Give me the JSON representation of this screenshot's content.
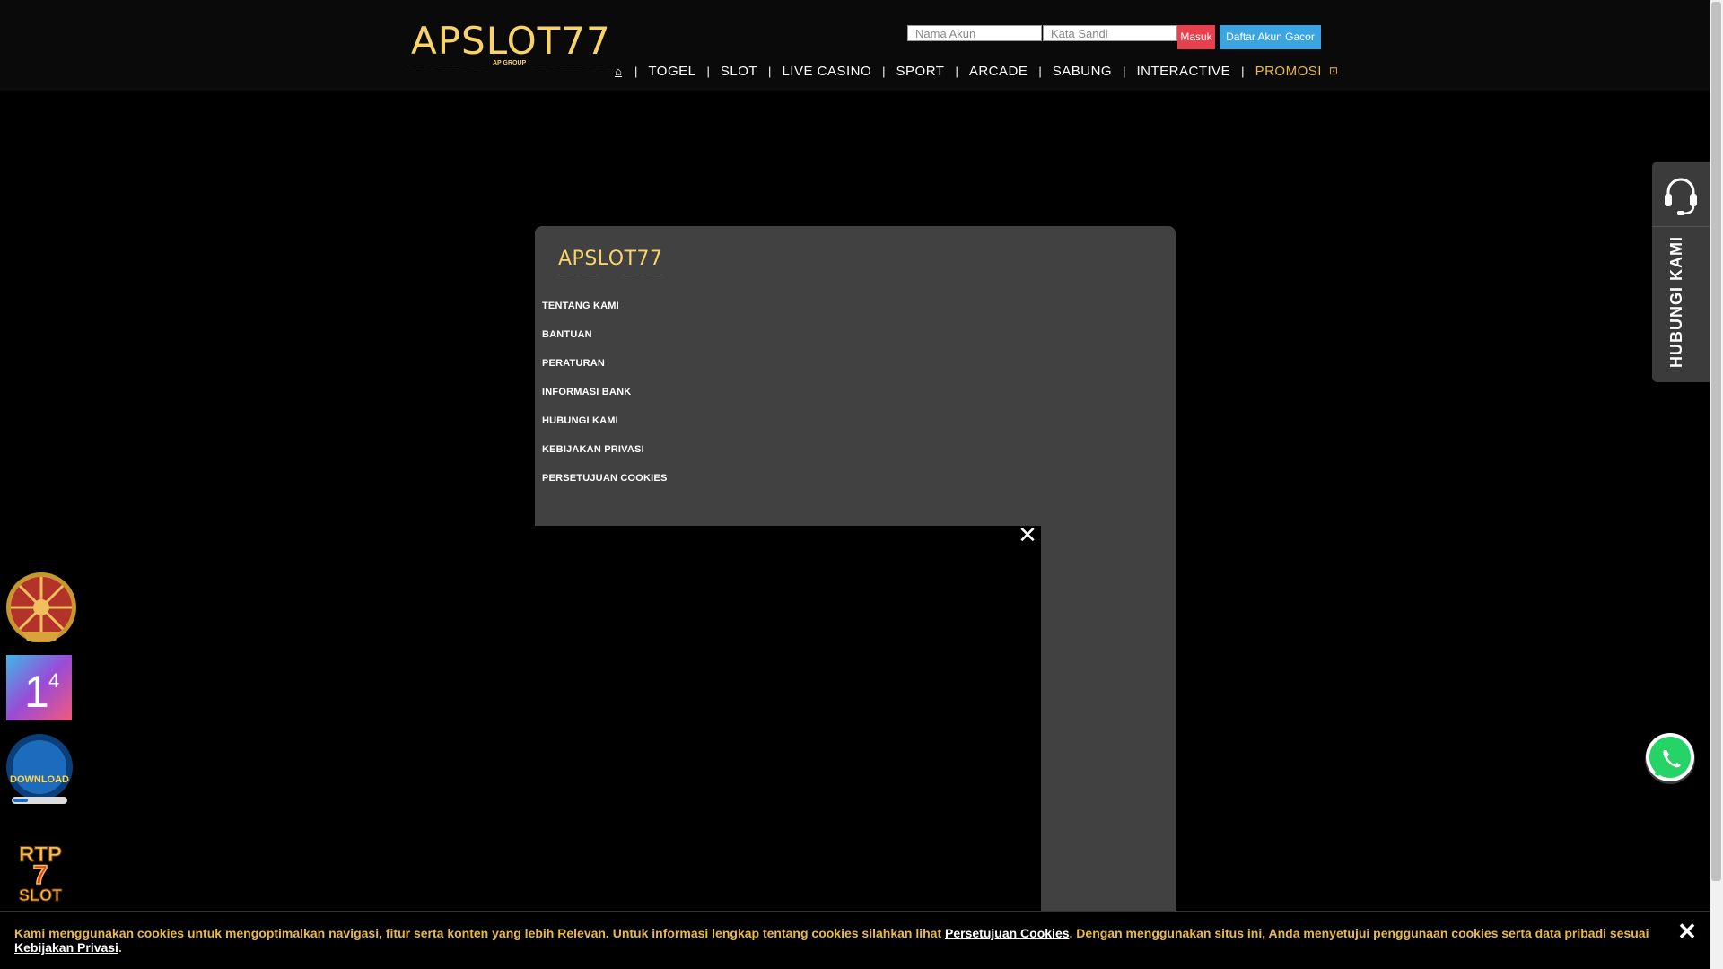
{
  "brand": {
    "name": "APSLOT77",
    "sub": "AP GROUP"
  },
  "login": {
    "username_placeholder": "Nama Akun",
    "password_placeholder": "Kata Sandi",
    "login_label": "Masuk",
    "register_label": "Daftar Akun Gacor"
  },
  "nav": {
    "home_icon": "home-icon",
    "items": [
      "TOGEL",
      "SLOT",
      "LIVE CASINO",
      "SPORT",
      "ARCADE",
      "SABUNG",
      "INTERACTIVE"
    ],
    "promo": "PROMOSI"
  },
  "footer_menu": {
    "items": [
      "TENTANG KAMI",
      "BANTUAN",
      "PERATURAN",
      "INFORMASI BANK",
      "HUBUNGI KAMI",
      "KEBIJAKAN PRIVASI",
      "PERSETUJUAN COOKIES"
    ]
  },
  "support": {
    "label": "HUBUNGI KAMI",
    "icon": "headset-icon"
  },
  "floating_icons": [
    "spin-wheel-icon",
    "1-4-icon",
    "download-app-icon",
    "rtp-slot-icon"
  ],
  "cookie": {
    "text_1": "Kami menggunakan cookies untuk mengoptimalkan navigasi, fitur serta konten yang lebih Relevan. Untuk informasi lengkap tentang cookies silahkan lihat ",
    "link_1": "Persetujuan Cookies",
    "text_2": ". Dengan menggunakan situs ini, Anda menyetujui penggunaan cookies serta data pribadi sesuai ",
    "link_2": "Kebijakan Privasi",
    "text_3": "."
  },
  "colors": {
    "gold": "#f7d36a",
    "promo": "#e9b94a",
    "login_red": "#e8414d",
    "register_blue": "#3aa5e0",
    "panel": "#414141"
  }
}
